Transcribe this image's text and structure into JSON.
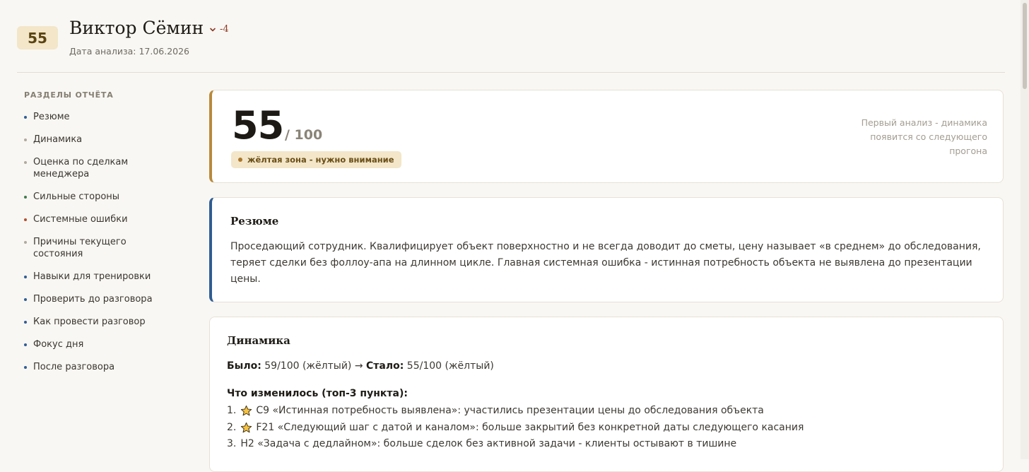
{
  "header": {
    "score_badge": "55",
    "name": "Виктор Сёмин",
    "trend_value": "-4",
    "trend_icon": "chevron-down-icon",
    "date_label": "Дата анализа: 17.06.2026"
  },
  "sidebar": {
    "title": "РАЗДЕЛЫ ОТЧЁТА",
    "items": [
      {
        "label": "Резюме",
        "dot_color": "#2f5d94"
      },
      {
        "label": "Динамика",
        "dot_color": "#b0aa9f"
      },
      {
        "label": "Оценка по сделкам менеджера",
        "dot_color": "#b0aa9f"
      },
      {
        "label": "Сильные стороны",
        "dot_color": "#3f7a4e"
      },
      {
        "label": "Системные ошибки",
        "dot_color": "#b0502f"
      },
      {
        "label": "Причины текущего состояния",
        "dot_color": "#b0aa9f"
      },
      {
        "label": "Навыки для тренировки",
        "dot_color": "#2f5d94"
      },
      {
        "label": "Проверить до разговора",
        "dot_color": "#2f5d94"
      },
      {
        "label": "Как провести разговор",
        "dot_color": "#2f5d94"
      },
      {
        "label": "Фокус дня",
        "dot_color": "#2f5d94"
      },
      {
        "label": "После разговора",
        "dot_color": "#2f5d94"
      }
    ]
  },
  "score_card": {
    "score": "55",
    "max": "/ 100",
    "zone": "жёлтая зона - нужно внимание",
    "zone_color": "#a9782c",
    "note": "Первый анализ - динамика появится со следующего прогона"
  },
  "resume": {
    "title": "Резюме",
    "text": "Проседающий сотрудник. Квалифицирует объект поверхностно и не всегда доводит до сметы, цену называет «в среднем» до обследования, теряет сделки без фоллоу-апа на длинном цикле. Главная системная ошибка - истинная потребность объекта не выявлена до презентации цены."
  },
  "dynamics": {
    "title": "Динамика",
    "was_label": "Было:",
    "was_value": "59/100 (жёлтый)",
    "arrow": "→",
    "now_label": "Стало:",
    "now_value": "55/100 (жёлтый)",
    "changes_title": "Что изменилось (топ-3 пункта):",
    "changes": [
      {
        "num": "1.",
        "star": true,
        "text": "C9 «Истинная потребность выявлена»: участились презентации цены до обследования объекта"
      },
      {
        "num": "2.",
        "star": true,
        "text": "F21 «Следующий шаг с датой и каналом»: больше закрытий без конкретной даты следующего касания"
      },
      {
        "num": "3.",
        "star": false,
        "text": "H2 «Задача с дедлайном»: больше сделок без активной задачи - клиенты остывают в тишине"
      }
    ]
  }
}
